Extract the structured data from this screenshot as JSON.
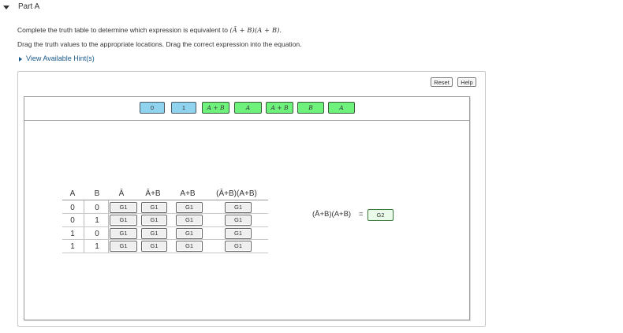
{
  "part": {
    "title": "Part A"
  },
  "instructions": {
    "line1_prefix": "Complete the truth table to determine which expression is equivalent to",
    "line1_expr": "(Ā + B)(A + B).",
    "line2": "Drag the truth values to the appropriate locations. Drag the correct expression into the equation."
  },
  "hint": {
    "label": "View Available Hint(s)"
  },
  "toolbar": {
    "reset_label": "Reset",
    "help_label": "Help"
  },
  "tray": {
    "chips": [
      {
        "label": "0",
        "kind": "value"
      },
      {
        "label": "1",
        "kind": "value"
      },
      {
        "label": "A + B",
        "kind": "expression"
      },
      {
        "label": "A",
        "kind": "expression"
      },
      {
        "label": "A + B",
        "kind": "expression"
      },
      {
        "label": "B",
        "kind": "expression"
      },
      {
        "label": "A",
        "kind": "expression"
      }
    ]
  },
  "truth_table": {
    "headers": [
      "A",
      "B",
      "Ā",
      "Ā+B",
      "A+B",
      "(Ā+B)(A+B)"
    ],
    "rows": [
      {
        "a": "0",
        "b": "0",
        "slots": [
          "G1",
          "G1",
          "G1",
          "G1"
        ]
      },
      {
        "a": "0",
        "b": "1",
        "slots": [
          "G1",
          "G1",
          "G1",
          "G1"
        ]
      },
      {
        "a": "1",
        "b": "0",
        "slots": [
          "G1",
          "G1",
          "G1",
          "G1"
        ]
      },
      {
        "a": "1",
        "b": "1",
        "slots": [
          "G1",
          "G1",
          "G1",
          "G1"
        ]
      }
    ]
  },
  "equation": {
    "lhs": "(Ā+B)(A+B)",
    "equals": "=",
    "slot": "G2"
  },
  "colors": {
    "value_chip": "#8fd3ef",
    "expression_chip": "#6ff27c",
    "link": "#1a5a8a"
  }
}
